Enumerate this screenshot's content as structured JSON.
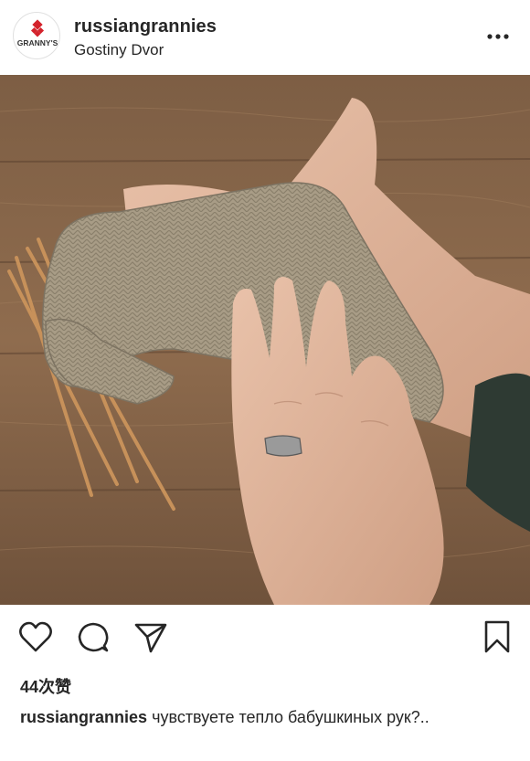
{
  "post": {
    "username": "russiangrannies",
    "location": "Gostiny Dvor",
    "avatar_logo_text": "GRANNY'S",
    "likes": "44次赞",
    "caption_user": "russiangrannies",
    "caption_text": "чувствуете тепло бабушкиных рук?.."
  },
  "icons": {
    "more": "more-horizontal-icon",
    "like": "heart-icon",
    "comment": "comment-bubble-icon",
    "share": "paper-plane-icon",
    "save": "bookmark-icon"
  },
  "colors": {
    "text": "#262626",
    "logo_red": "#d4232c",
    "wood": "#8a6749",
    "yarn": "#a89c86"
  }
}
